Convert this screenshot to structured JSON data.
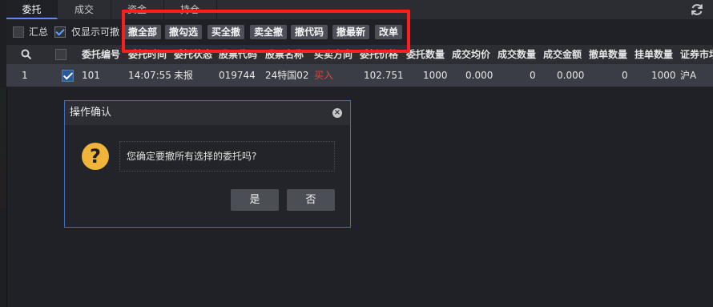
{
  "tabs": [
    {
      "label": "委托"
    },
    {
      "label": "成交"
    },
    {
      "label": "资金"
    },
    {
      "label": "持仓"
    }
  ],
  "toolbar": {
    "summary_label": "汇总",
    "summary_checked": false,
    "cancelable_only_label": "仅显示可撤",
    "cancelable_only_checked": true,
    "buttons": [
      {
        "label": "撤全部"
      },
      {
        "label": "撤勾选"
      },
      {
        "label": "买全撤"
      },
      {
        "label": "卖全撤"
      },
      {
        "label": "撤代码"
      },
      {
        "label": "撤最新"
      },
      {
        "label": "改单"
      }
    ]
  },
  "table": {
    "columns": [
      "委托编号",
      "委托时间",
      "委托状态",
      "股票代码",
      "股票名称",
      "买卖方向",
      "委托价格",
      "委托数量",
      "成交均价",
      "成交数量",
      "成交金额",
      "撤单数量",
      "挂单数量",
      "证券市场"
    ],
    "rows": [
      {
        "index": "1",
        "selected": true,
        "order_no": "101",
        "time": "14:07:55",
        "status": "未报",
        "code": "019744",
        "name": "24特国02",
        "side": "买入",
        "price": "102.751",
        "qty": "1000",
        "avg_price": "0.000",
        "filled_qty": "0",
        "filled_amount": "0.000",
        "cancel_qty": "0",
        "pending_qty": "1000",
        "market": "沪A"
      }
    ]
  },
  "dialog": {
    "title": "操作确认",
    "message": "您确定要撤所有选择的委托吗?",
    "yes_label": "是",
    "no_label": "否"
  },
  "colors": {
    "accent": "#5b8def",
    "buy": "#e2443a",
    "highlight_box": "#ff1e1e",
    "question_icon": "#f0b43a"
  }
}
